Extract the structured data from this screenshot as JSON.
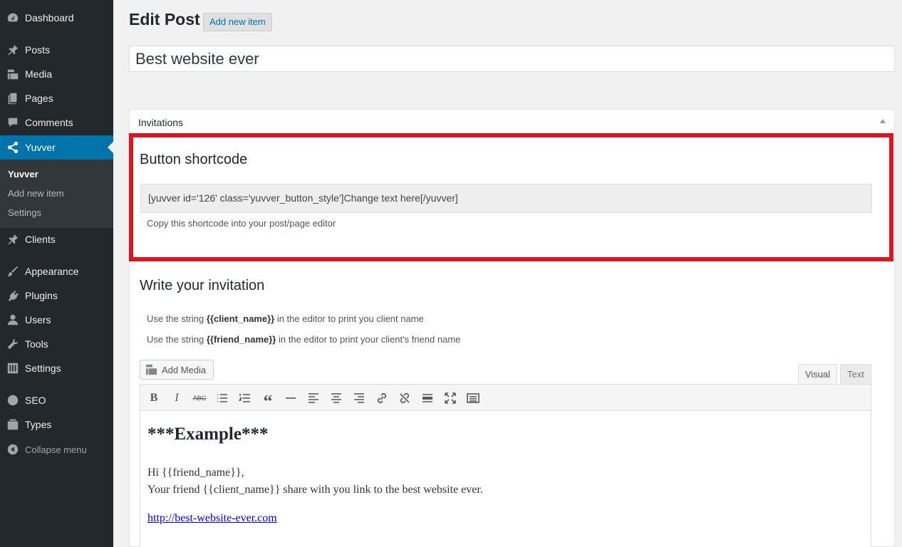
{
  "sidebar": {
    "items": [
      {
        "label": "Dashboard",
        "icon": "dashboard-icon"
      },
      {
        "label": "Posts",
        "icon": "pin-icon"
      },
      {
        "label": "Media",
        "icon": "media-icon"
      },
      {
        "label": "Pages",
        "icon": "pages-icon"
      },
      {
        "label": "Comments",
        "icon": "comment-icon"
      },
      {
        "label": "Yuvver",
        "icon": "share-icon",
        "active": true
      },
      {
        "label": "Clients",
        "icon": "pin-icon"
      },
      {
        "label": "Appearance",
        "icon": "brush-icon"
      },
      {
        "label": "Plugins",
        "icon": "plug-icon"
      },
      {
        "label": "Users",
        "icon": "user-icon"
      },
      {
        "label": "Tools",
        "icon": "wrench-icon"
      },
      {
        "label": "Settings",
        "icon": "sliders-icon"
      },
      {
        "label": "SEO",
        "icon": "seo-icon"
      },
      {
        "label": "Types",
        "icon": "types-icon"
      }
    ],
    "submenu": [
      "Yuvver",
      "Add new item",
      "Settings"
    ],
    "collapse_label": "Collapse menu"
  },
  "header": {
    "title": "Edit Post",
    "add_new_label": "Add new item"
  },
  "post_title": "Best website ever",
  "postbox": {
    "title": "Invitations",
    "shortcode_heading": "Button shortcode",
    "shortcode": "[yuvver id='126' class='yuvver_button_style']Change text here[/yuvver]",
    "shortcode_help": "Copy this shortcode into your post/page editor",
    "invite_heading": "Write your invitation",
    "hint1": {
      "pre": "Use the string ",
      "token": "{{client_name}}",
      "post": " in the editor to print you client name"
    },
    "hint2": {
      "pre": "Use the string ",
      "token": "{{friend_name}}",
      "post": " in the editor to print your client's friend name"
    },
    "highlight_color": "#e0131f"
  },
  "editor": {
    "add_media_label": "Add Media",
    "tab_visual": "Visual",
    "tab_text": "Text",
    "content": {
      "heading": "***Example***",
      "line1": "Hi {{friend_name}},",
      "line2": "Your friend {{client_name}} share with you link to the best website ever.",
      "link": "http://best-website-ever.com"
    }
  },
  "colors": {
    "sidebar_bg": "#23282d",
    "active_menu": "#0073aa",
    "link": "#0073aa"
  }
}
